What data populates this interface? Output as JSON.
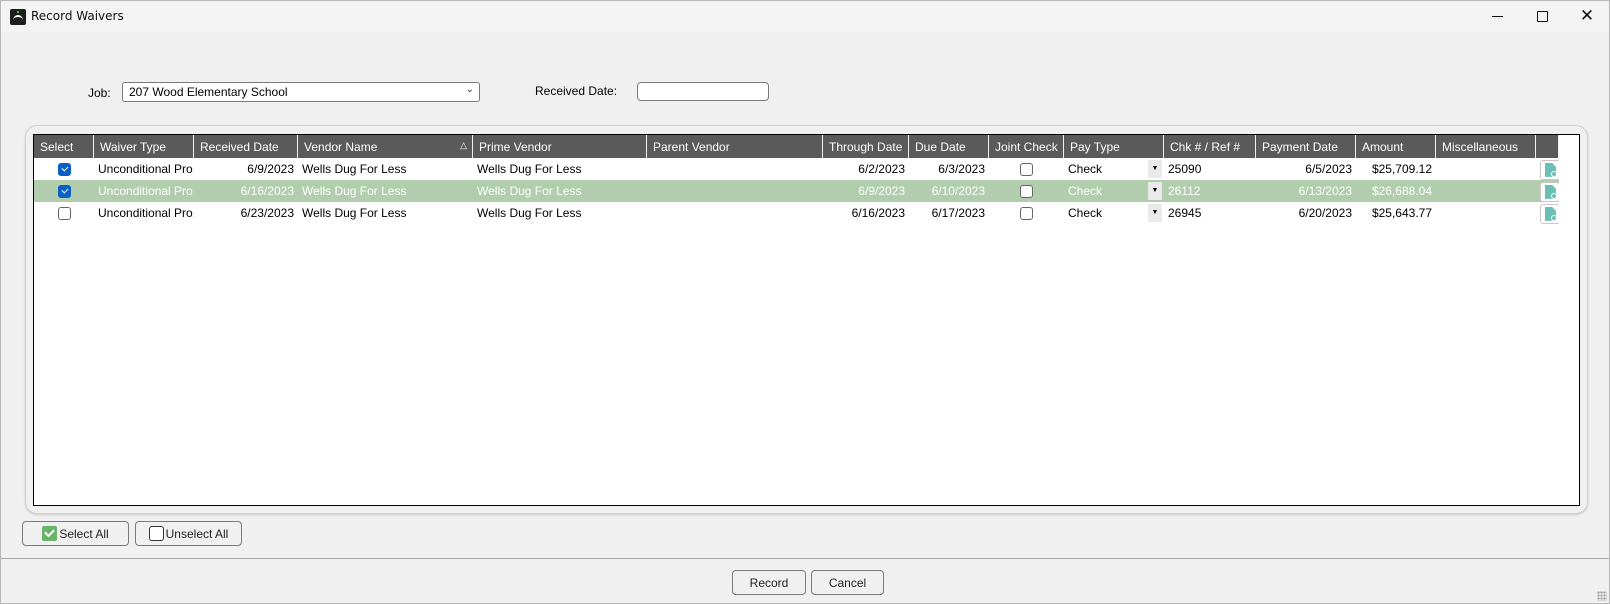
{
  "window": {
    "title": "Record Waivers",
    "controls": {
      "minimize": "minimize",
      "maximize": "maximize",
      "close": "✕"
    }
  },
  "filters": {
    "job_label": "Job:",
    "job_value": "207  Wood Elementary School",
    "received_date_label": "Received Date:",
    "received_date_value": ""
  },
  "grid": {
    "columns": [
      {
        "key": "select",
        "label": "Select"
      },
      {
        "key": "waiver_type",
        "label": "Waiver Type"
      },
      {
        "key": "received_date",
        "label": "Received Date"
      },
      {
        "key": "vendor_name",
        "label": "Vendor Name",
        "sort": "△"
      },
      {
        "key": "prime_vendor",
        "label": "Prime Vendor"
      },
      {
        "key": "parent_vendor",
        "label": "Parent Vendor"
      },
      {
        "key": "through_date",
        "label": "Through Date"
      },
      {
        "key": "due_date",
        "label": "Due Date"
      },
      {
        "key": "joint_check",
        "label": "Joint Check"
      },
      {
        "key": "pay_type",
        "label": "Pay Type"
      },
      {
        "key": "chk_ref",
        "label": "Chk # / Ref #"
      },
      {
        "key": "payment_date",
        "label": "Payment Date"
      },
      {
        "key": "amount",
        "label": "Amount"
      },
      {
        "key": "misc",
        "label": "Miscellaneous"
      },
      {
        "key": "view",
        "label": ""
      }
    ],
    "rows": [
      {
        "selected": true,
        "highlighted": false,
        "waiver_type": "Unconditional Pro...",
        "received_date": "6/9/2023",
        "vendor_name": "Wells Dug For Less",
        "prime_vendor": "Wells Dug For Less",
        "parent_vendor": "",
        "through_date": "6/2/2023",
        "due_date": "6/3/2023",
        "joint_check": false,
        "pay_type": "Check",
        "chk_ref": "25090",
        "payment_date": "6/5/2023",
        "amount": "$25,709.12",
        "misc": ""
      },
      {
        "selected": true,
        "highlighted": true,
        "waiver_type": "Unconditional Pro...",
        "received_date": "6/16/2023",
        "vendor_name": "Wells Dug For Less",
        "prime_vendor": "Wells Dug For Less",
        "parent_vendor": "",
        "through_date": "6/9/2023",
        "due_date": "6/10/2023",
        "joint_check": false,
        "pay_type": "Check",
        "chk_ref": "26112",
        "payment_date": "6/13/2023",
        "amount": "$26,688.04",
        "misc": ""
      },
      {
        "selected": false,
        "highlighted": false,
        "waiver_type": "Unconditional Pro...",
        "received_date": "6/23/2023",
        "vendor_name": "Wells Dug For Less",
        "prime_vendor": "Wells Dug For Less",
        "parent_vendor": "",
        "through_date": "6/16/2023",
        "due_date": "6/17/2023",
        "joint_check": false,
        "pay_type": "Check",
        "chk_ref": "26945",
        "payment_date": "6/20/2023",
        "amount": "$25,643.77",
        "misc": ""
      }
    ]
  },
  "buttons": {
    "select_all": "Select All",
    "unselect_all": "Unselect All",
    "record": "Record",
    "cancel": "Cancel"
  },
  "colors": {
    "header_bg": "#5a5a5a",
    "selected_row_bg": "#b1cdae",
    "checkbox_accent": "#0a5fc4",
    "doc_icon": "#6cbfb3"
  }
}
